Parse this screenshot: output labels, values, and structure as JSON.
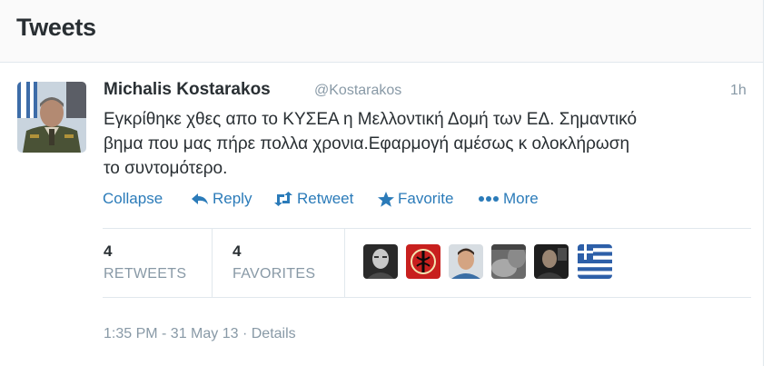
{
  "header": {
    "title": "Tweets"
  },
  "tweet": {
    "author_name": "Michalis Kostarakos",
    "author_handle": "@Kostarakos",
    "time_ago": "1h",
    "text_lines": [
      "Εγκρίθηκε χθες απο το ΚΥΣΕΑ η Μελλοντική Δομή των ΕΔ. Σημαντικό",
      "βημα που μας πήρε πολλα χρονια.Εφαρμογή αμέσως κ ολοκλήρωση",
      "το συντομότερο."
    ]
  },
  "actions": {
    "collapse": "Collapse",
    "reply": "Reply",
    "retweet": "Retweet",
    "favorite": "Favorite",
    "more": "More"
  },
  "stats": {
    "retweets_count": "4",
    "retweets_label": "RETWEETS",
    "favorites_count": "4",
    "favorites_label": "FAVORITES"
  },
  "favoriters": [
    {
      "icon": "user-avatar-1"
    },
    {
      "icon": "user-avatar-2"
    },
    {
      "icon": "user-avatar-3"
    },
    {
      "icon": "user-avatar-4"
    },
    {
      "icon": "user-avatar-5"
    },
    {
      "icon": "greek-flag-avatar"
    }
  ],
  "footer": {
    "timestamp": "1:35 PM - 31 May 13",
    "separator": "·",
    "details": "Details"
  },
  "colors": {
    "link": "#2b7bb9",
    "text": "#292f33",
    "muted": "#8899a6",
    "border": "#e1e8ed"
  }
}
